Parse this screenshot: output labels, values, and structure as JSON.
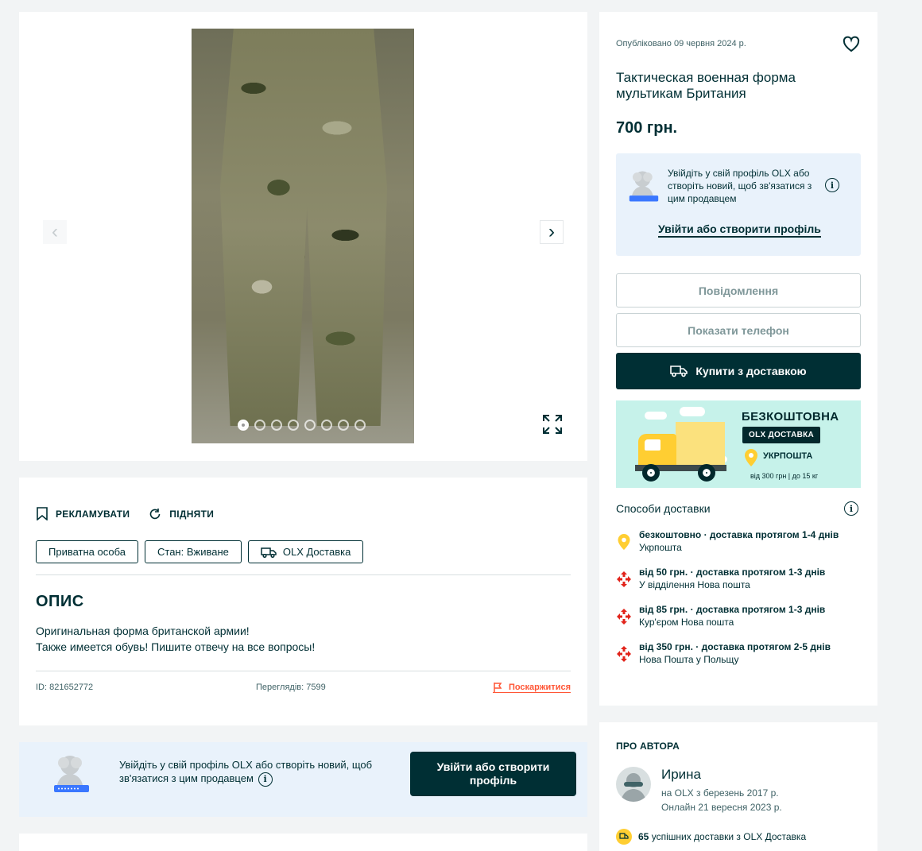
{
  "gallery": {
    "photo_count": 8,
    "active_index": 0
  },
  "ad": {
    "published": "Опубліковано 09 червня 2024 р.",
    "title": "Тактическая военная форма мультикам Британия",
    "price": "700 грн."
  },
  "login_box": {
    "text": "Увійдіть у свій профіль OLX або створіть новий, щоб зв'язатися з цим продавцем",
    "link": "Увійти або створити профіль"
  },
  "buttons": {
    "message": "Повідомлення",
    "show_phone": "Показати телефон",
    "buy_delivery": "Купити з доставкою"
  },
  "promo": {
    "free": "БЕЗКОШТОВНА",
    "olx_delivery": "OLX ДОСТАВКА",
    "ukrposhta": "УКРПОШТА",
    "terms": "від 300 грн | до 15 кг"
  },
  "delivery": {
    "title": "Способи доставки",
    "items": [
      {
        "line1": "безкоштовно · доставка протягом 1-4 днів",
        "line2": "Укрпошта",
        "icon": "ukrposhta-pin-icon"
      },
      {
        "line1": "від 50 грн. · доставка протягом 1-3 днів",
        "line2": "У відділення Нова пошта",
        "icon": "nova-poshta-icon"
      },
      {
        "line1": "від 85 грн. · доставка протягом 1-3 днів",
        "line2": "Кур'єром Нова пошта",
        "icon": "nova-poshta-icon"
      },
      {
        "line1": "від 350 грн. · доставка протягом 2-5 днів",
        "line2": "Нова Пошта у Польщу",
        "icon": "nova-poshta-icon"
      }
    ]
  },
  "description": {
    "promote": "РЕКЛАМУВАТИ",
    "raise": "ПІДНЯТИ",
    "tags": [
      "Приватна особа",
      "Стан: Вживане",
      "OLX Доставка"
    ],
    "heading": "ОПИС",
    "text_line1": "Оригинальная форма британской армии!",
    "text_line2": "Также имеется обувь! Пишите отвечу на все вопросы!",
    "id": "ID: 821652772",
    "views": "Переглядів: 7599",
    "complain": "Поскаржитися"
  },
  "login_banner": {
    "text": "Увійдіть у свій профіль OLX або створіть новий, щоб зв'язатися з цим продавцем",
    "button": "Увійти або створити профіль"
  },
  "author": {
    "title": "ПРО АВТОРА",
    "name": "Ирина",
    "since": "на OLX з березень 2017 р.",
    "online": "Онлайн 21 вересня 2023 р.",
    "deliveries_count": "65",
    "deliveries_text": "успішних доставки з OLX Доставка"
  },
  "colors": {
    "primary": "#002f34",
    "accent_orange": "#ff5636",
    "login_bg": "#e9f2fb",
    "promo_bg": "#c6f2ea"
  }
}
